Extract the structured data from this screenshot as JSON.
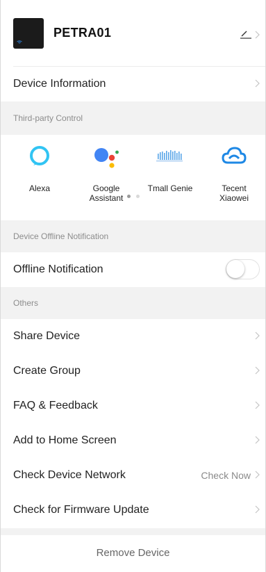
{
  "device": {
    "name": "PETRA01"
  },
  "rows": {
    "device_information": "Device Information",
    "offline_notification": "Offline Notification",
    "share_device": "Share Device",
    "create_group": "Create Group",
    "faq_feedback": "FAQ & Feedback",
    "add_home_screen": "Add to Home Screen",
    "check_network": "Check Device Network",
    "check_network_value": "Check Now",
    "firmware_update": "Check for Firmware Update"
  },
  "sections": {
    "third_party": "Third-party Control",
    "offline": "Device Offline Notification",
    "others": "Others"
  },
  "third_party": {
    "items": [
      {
        "label": "Alexa",
        "icon": "alexa-icon"
      },
      {
        "label": "Google\nAssistant",
        "icon": "google-assistant-icon"
      },
      {
        "label": "Tmall Genie",
        "icon": "tmall-genie-icon"
      },
      {
        "label": "Tecent\nXiaowei",
        "icon": "tecent-xiaowei-icon"
      }
    ],
    "page_count": 2,
    "active_page": 1
  },
  "toggles": {
    "offline_notification_on": false
  },
  "actions": {
    "remove_device": "Remove Device"
  },
  "colors": {
    "alexa_blue": "#31C4F3",
    "google_blue": "#4285F4",
    "google_red": "#EA4335",
    "google_yellow": "#FBBC05",
    "google_green": "#34A853",
    "tmall_blue": "#5aa6e8",
    "tecent_blue": "#1e88e5"
  }
}
